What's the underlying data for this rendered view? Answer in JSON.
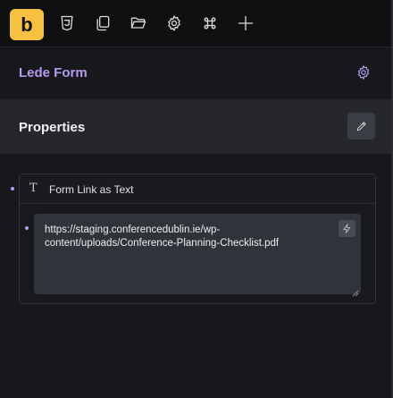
{
  "toolbar": {
    "logo_letter": "b",
    "icons": [
      "css3-icon",
      "copy-icon",
      "folder-icon",
      "settings-icon",
      "command-icon",
      "plus-icon"
    ]
  },
  "panel": {
    "title": "Lede Form",
    "settings_icon": "gear-icon"
  },
  "properties": {
    "title": "Properties",
    "edit_icon": "pencil-icon"
  },
  "field": {
    "type_icon": "text-type-icon",
    "label": "Form Link as Text",
    "value": "https://staging.conferencedublin.ie/wp-content/uploads/Conference-Planning-Checklist.pdf",
    "dynamic_icon": "lightning-icon"
  },
  "colors": {
    "accent": "#b59bf0",
    "logo": "#f6c141",
    "background": "#17181b",
    "properties_bar": "#25272c"
  }
}
